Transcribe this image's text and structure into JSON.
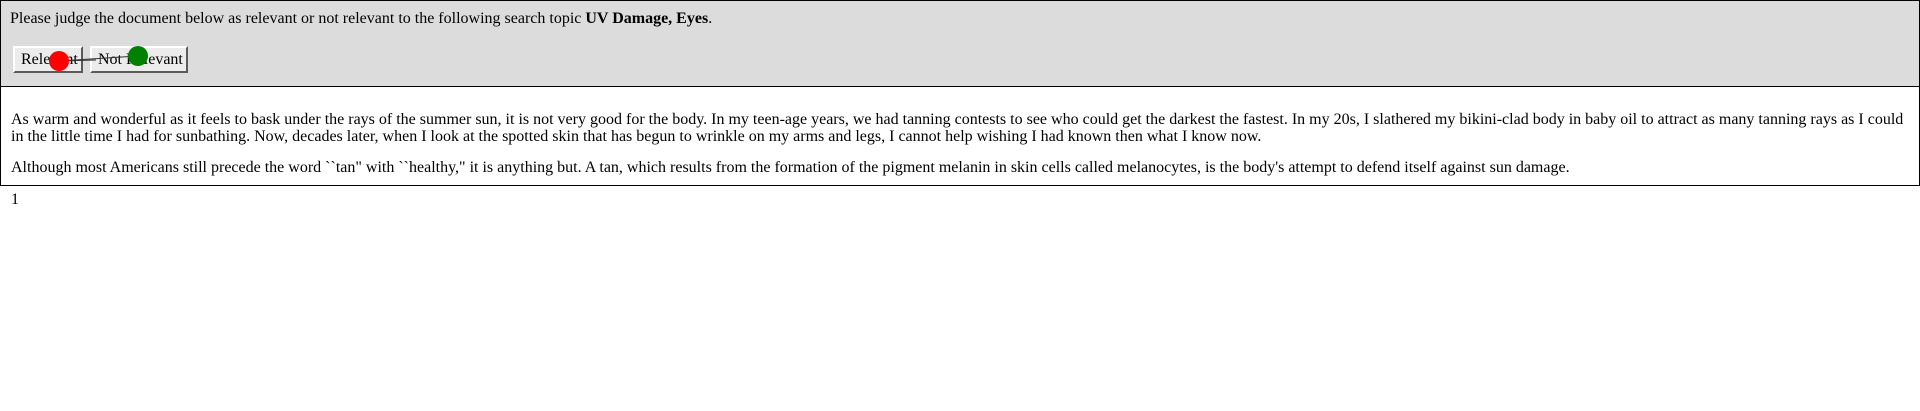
{
  "prompt": {
    "text_before": "Please judge the document below as relevant or not relevant to the following search topic ",
    "topic": "UV Damage, Eyes",
    "text_after": "."
  },
  "buttons": {
    "relevant_label": "Relevant",
    "not_relevant_label": "Not Relevant"
  },
  "cursor_markers": {
    "start_color": "#ff0000",
    "end_color": "#008000",
    "trail_color": "#333333"
  },
  "document": {
    "paragraphs": [
      "As warm and wonderful as it feels to bask under the rays of the summer sun, it is not very good for the body. In my teen-age years, we had tanning contests to see who could get the darkest the fastest. In my 20s, I slathered my bikini-clad body in baby oil to attract as many tanning rays as I could in the little time I had for sunbathing. Now, decades later, when I look at the spotted skin that has begun to wrinkle on my arms and legs, I cannot help wishing I had known then what I know now.",
      "Although most Americans still precede the word ``tan\" with ``healthy,\" it is anything but. A tan, which results from the formation of the pigment melanin in skin cells called melanocytes, is the body's attempt to defend itself against sun damage."
    ],
    "page_number": "1"
  }
}
